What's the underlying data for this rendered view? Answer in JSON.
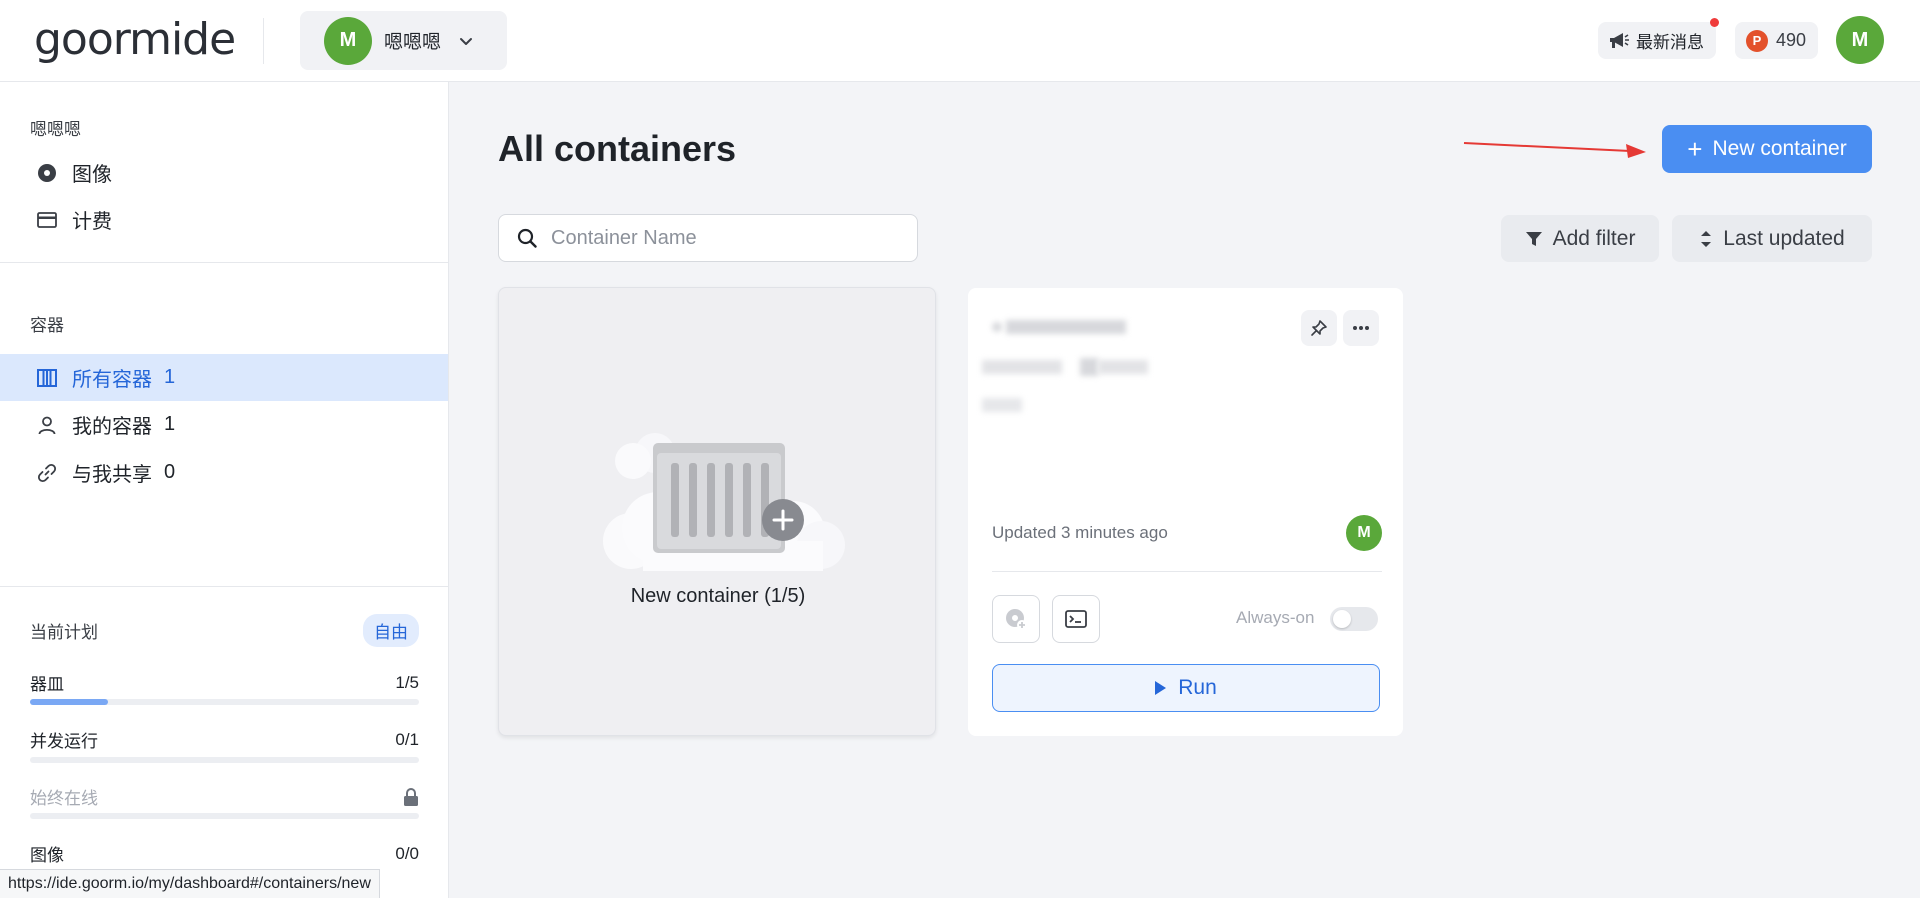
{
  "header": {
    "logo": "goormide",
    "org": {
      "avatar_letter": "M",
      "name": "嗯嗯嗯"
    },
    "news_label": "最新消息",
    "points": {
      "badge": "P",
      "value": "490"
    },
    "user_avatar_letter": "M"
  },
  "sidebar": {
    "org_title": "嗯嗯嗯",
    "org_items": [
      {
        "label": "图像",
        "icon": "disc-icon"
      },
      {
        "label": "计费",
        "icon": "credit-card-icon"
      }
    ],
    "containers_title": "容器",
    "container_items": [
      {
        "label": "所有容器",
        "count": "1",
        "icon": "columns-icon",
        "active": true
      },
      {
        "label": "我的容器",
        "count": "1",
        "icon": "user-icon"
      },
      {
        "label": "与我共享",
        "count": "0",
        "icon": "link-icon"
      }
    ],
    "plan": {
      "label": "当前计划",
      "badge": "自由",
      "rows": [
        {
          "label": "器皿",
          "value": "1/5",
          "progress": 0.2
        },
        {
          "label": "并发运行",
          "value": "0/1",
          "progress": 0
        },
        {
          "label": "始终在线",
          "value": "",
          "progress": 0,
          "locked": true
        },
        {
          "label": "图像",
          "value": "0/0",
          "progress": 0
        }
      ]
    }
  },
  "status_bar_url": "https://ide.goorm.io/my/dashboard#/containers/new",
  "main": {
    "title": "All containers",
    "new_button": "New container",
    "search_placeholder": "Container Name",
    "filter_button": "Add filter",
    "sort_button": "Last updated",
    "new_card_label": "New container (1/5)",
    "container_card": {
      "updated": "Updated 3 minutes ago",
      "owner_avatar_letter": "M",
      "always_on_label": "Always-on",
      "always_on": false,
      "run_label": "Run"
    }
  },
  "colors": {
    "accent": "#4a8ef2",
    "avatar_green": "#5aa83a",
    "active_bg": "#dbe8fd",
    "annotation_arrow": "#e53935"
  }
}
